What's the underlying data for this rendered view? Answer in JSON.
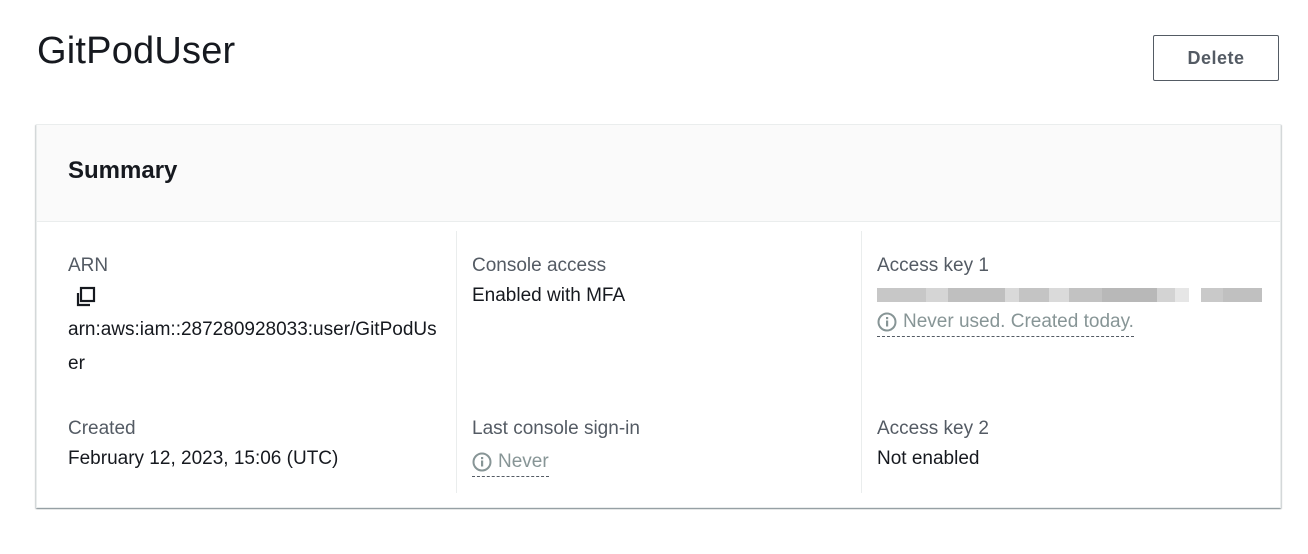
{
  "page": {
    "title": "GitPodUser",
    "delete_label": "Delete"
  },
  "summary": {
    "title": "Summary",
    "arn": {
      "label": "ARN",
      "value": "arn:aws:iam::287280928033:user/GitPodUser"
    },
    "created": {
      "label": "Created",
      "value": "February 12, 2023, 15:06 (UTC)"
    },
    "console_access": {
      "label": "Console access",
      "value": "Enabled with MFA"
    },
    "last_signin": {
      "label": "Last console sign-in",
      "value": "Never"
    },
    "access_key_1": {
      "label": "Access key 1",
      "status": "Never used. Created today."
    },
    "access_key_2": {
      "label": "Access key 2",
      "value": "Not enabled"
    }
  },
  "icons": {
    "copy": "copy-icon",
    "info": "info-icon"
  },
  "colors": {
    "text": "#16191f",
    "label": "#545b64",
    "muted": "#879596",
    "header_bg": "#fafafa",
    "border": "#eaeded"
  }
}
